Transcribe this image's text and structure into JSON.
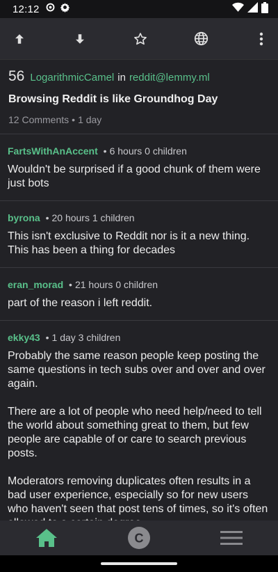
{
  "status_bar": {
    "time": "12:12",
    "left_icons": [
      "settings-icon",
      "gear-icon"
    ],
    "right_icons": [
      "wifi-icon",
      "signal-icon",
      "battery-icon"
    ]
  },
  "toolbar": {
    "icons": [
      "arrow-up-icon",
      "arrow-down-icon",
      "star-icon",
      "globe-icon",
      "more-vert-icon"
    ]
  },
  "post": {
    "score": "56",
    "author": "LogarithmicCamel",
    "in_label": "in",
    "community": "reddit@lemmy.ml",
    "title": "Browsing Reddit is like Groundhog Day",
    "comments_count": "12 Comments",
    "age": "1 day"
  },
  "comments": [
    {
      "author": "FartsWithAnAccent",
      "meta": "6 hours 0 children",
      "paragraphs": [
        "Wouldn't be surprised if a good chunk of them were just bots"
      ]
    },
    {
      "author": "byrona",
      "meta": "20 hours 1 children",
      "paragraphs": [
        "This isn't exclusive to Reddit nor is it a new thing. This has been a thing for decades"
      ]
    },
    {
      "author": "eran_morad",
      "meta": "21 hours 0 children",
      "paragraphs": [
        "part of the reason i left reddit."
      ]
    },
    {
      "author": "ekky43",
      "meta": "1 day 3 children",
      "paragraphs": [
        "Probably the same reason people keep posting the same questions in tech subs over and over and over again.",
        "There are a lot of people who need help/need to tell the world about something great to them, but few people are capable of or care to search previous posts.",
        "Moderators removing duplicates often results in a bad user experience, especially so for new users who haven't seen that post tens of times, so it's often allowed to a certain degree."
      ]
    }
  ],
  "bottom_nav": {
    "items": [
      "home-icon",
      "communities-icon",
      "menu-icon"
    ],
    "active": "home-icon",
    "community_letter": "C"
  },
  "colors": {
    "accent": "#59c08a",
    "background": "#222226",
    "toolbar": "#2b2b30"
  }
}
